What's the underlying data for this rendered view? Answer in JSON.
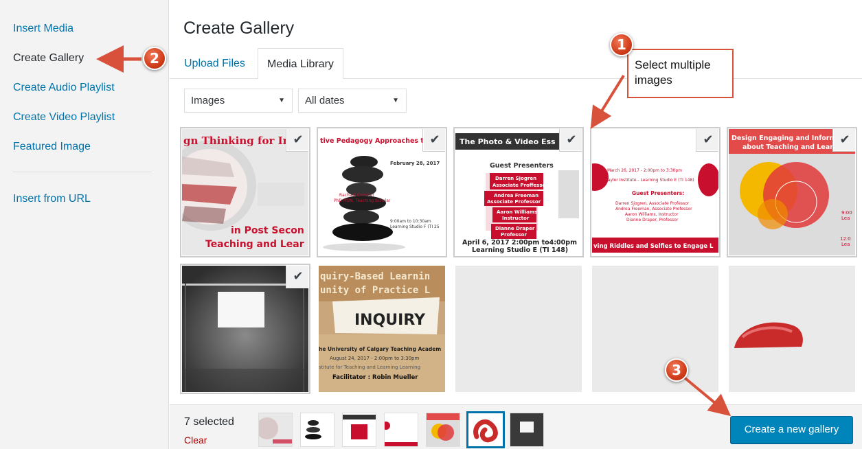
{
  "sidebar": {
    "items": [
      {
        "label": "Insert Media"
      },
      {
        "label": "Create Gallery"
      },
      {
        "label": "Create Audio Playlist"
      },
      {
        "label": "Create Video Playlist"
      },
      {
        "label": "Featured Image"
      },
      {
        "label": "Insert from URL"
      }
    ],
    "active_index": 1
  },
  "header": {
    "title": "Create Gallery",
    "tabs": [
      {
        "label": "Upload Files"
      },
      {
        "label": "Media Library"
      }
    ],
    "active_tab": 1
  },
  "filters": {
    "type_select": "Images",
    "date_select": "All dates"
  },
  "attachments": [
    {
      "selected": true,
      "check_icon": "checkmark-icon",
      "text_lines": [
        "gn Thinking for Inn",
        "in Post Secon",
        "Teaching and Lear"
      ]
    },
    {
      "selected": true,
      "check_icon": "checkmark-icon",
      "text_lines": [
        "tive Pedagogy Approaches to Re",
        "February 28, 2017",
        "Rachael Crowder",
        "PhD RSW, Teaching Scholar",
        "9:00am to 10:30am",
        "Learning Studio F (TI 25"
      ]
    },
    {
      "selected": true,
      "check_icon": "checkmark-icon",
      "text_lines": [
        "The Photo & Video Ess",
        "Guest Presenters",
        "Darren Sjogren",
        "Associate Proffessor",
        "Andrea Freeman",
        "Associate Professor",
        "Aaron Williams",
        "Instructor",
        "Dianne Draper",
        "Professor",
        "April 6, 2017 2:00pm to4:00pm",
        "Learning Studio E (TI 148)"
      ]
    },
    {
      "selected": true,
      "check_icon": "checkmark-icon",
      "text_lines": [
        "March 26, 2017 - 2:00pm to 3:30pm",
        "Taylor Institute - Learning Studio E (TI 148)",
        "Guest Presenters:",
        "Darren Sjogren, Associate Professor",
        "Andrea Freeman, Associate Professor",
        "Aaron Williams, Instructor",
        "Dianne Draper, Professor",
        "ving Riddles and Selfies to Engage L"
      ]
    },
    {
      "selected": true,
      "check_icon": "checkmark-icon",
      "text_lines": [
        "Design Engaging and Informat",
        "about Teaching and Learning",
        "9:00",
        "Lea",
        "12:0",
        "Lea"
      ]
    },
    {
      "selected": true,
      "check_icon": "checkmark-icon",
      "text_lines": []
    },
    {
      "selected": false,
      "check_icon": "",
      "text_lines": [
        "quiry-Based Learnin",
        "unity of Practice L",
        "INQUIRY",
        "he University of Calgary Teaching Academ",
        "August 24, 2017 - 2:00pm to 3:30pm",
        "stitute for Teaching and Learning Learning",
        "Facilitator : Robin Mueller"
      ]
    },
    {
      "selected": false,
      "check_icon": "",
      "text_lines": []
    },
    {
      "selected": false,
      "check_icon": "",
      "text_lines": []
    },
    {
      "selected": false,
      "check_icon": "",
      "text_lines": []
    }
  ],
  "toolbar": {
    "selected_count": "7 selected",
    "clear_label": "Clear",
    "create_button": "Create a new gallery"
  },
  "annotations": {
    "callout_text_1": "Select multiple",
    "callout_text_2": "images",
    "badge_1": "1",
    "badge_2": "2",
    "badge_3": "3",
    "color": "#d13d1a"
  },
  "colors": {
    "link": "#0073aa",
    "primary_button": "#0085ba",
    "clear": "#a00",
    "accent_red": "#c8102e"
  }
}
